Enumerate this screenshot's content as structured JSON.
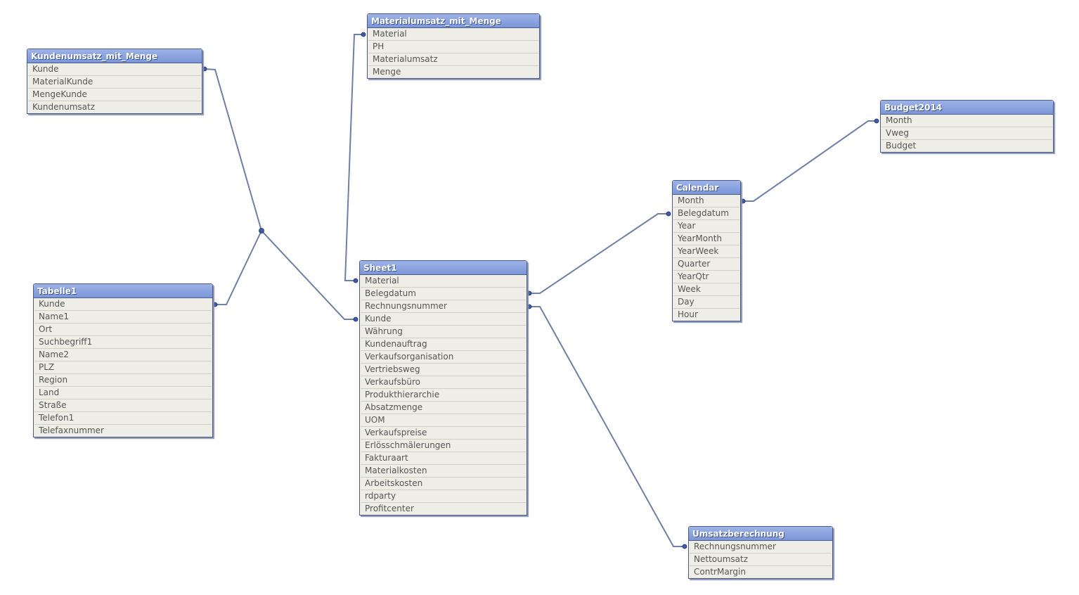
{
  "tables": [
    {
      "id": "kundenumsatz",
      "title": "Kundenumsatz_mit_Menge",
      "fields": [
        "Kunde",
        "MaterialKunde",
        "MengeKunde",
        "Kundenumsatz"
      ]
    },
    {
      "id": "materialumsatz",
      "title": "Materialumsatz_mit_Menge",
      "fields": [
        "Material",
        "PH",
        "Materialumsatz",
        "Menge"
      ]
    },
    {
      "id": "budget2014",
      "title": "Budget2014",
      "fields": [
        "Month",
        "Vweg",
        "Budget"
      ]
    },
    {
      "id": "calendar",
      "title": "Calendar",
      "fields": [
        "Month",
        "Belegdatum",
        "Year",
        "YearMonth",
        "YearWeek",
        "Quarter",
        "YearQtr",
        "Week",
        "Day",
        "Hour"
      ]
    },
    {
      "id": "tabelle1",
      "title": "Tabelle1",
      "fields": [
        "Kunde",
        "Name1",
        "Ort",
        "Suchbegriff1",
        "Name2",
        "PLZ",
        "Region",
        "Land",
        "Straße",
        "Telefon1",
        "Telefaxnummer"
      ]
    },
    {
      "id": "sheet1",
      "title": "Sheet1",
      "fields": [
        "Material",
        "Belegdatum",
        "Rechnungsnummer",
        "Kunde",
        "Währung",
        "Kundenauftrag",
        "Verkaufsorganisation",
        "Vertriebsweg",
        "Verkaufsbüro",
        "Produkthierarchie",
        "Absatzmenge",
        "UOM",
        "Verkaufspreise",
        "Erlösschmälerungen",
        "Fakturaart",
        "Materialkosten",
        "Arbeitskosten",
        "rdparty",
        "Profitcenter"
      ]
    },
    {
      "id": "umsatzberechnung",
      "title": "Umsatzberechnung",
      "fields": [
        "Rechnungsnummer",
        "Nettoumsatz",
        "ContrMargin"
      ]
    }
  ],
  "links": [
    {
      "field": "Kunde",
      "tables": [
        "Kundenumsatz_mit_Menge",
        "Tabelle1",
        "Sheet1"
      ]
    },
    {
      "field": "Material",
      "tables": [
        "Materialumsatz_mit_Menge",
        "Sheet1"
      ]
    },
    {
      "field": "Belegdatum",
      "tables": [
        "Sheet1",
        "Calendar"
      ]
    },
    {
      "field": "Rechnungsnummer",
      "tables": [
        "Sheet1",
        "Umsatzberechnung"
      ]
    },
    {
      "field": "Month",
      "tables": [
        "Calendar",
        "Budget2014"
      ]
    }
  ],
  "colors": {
    "header": "#7b96d8",
    "line": "#6f7fa6",
    "body": "#efeee6"
  }
}
